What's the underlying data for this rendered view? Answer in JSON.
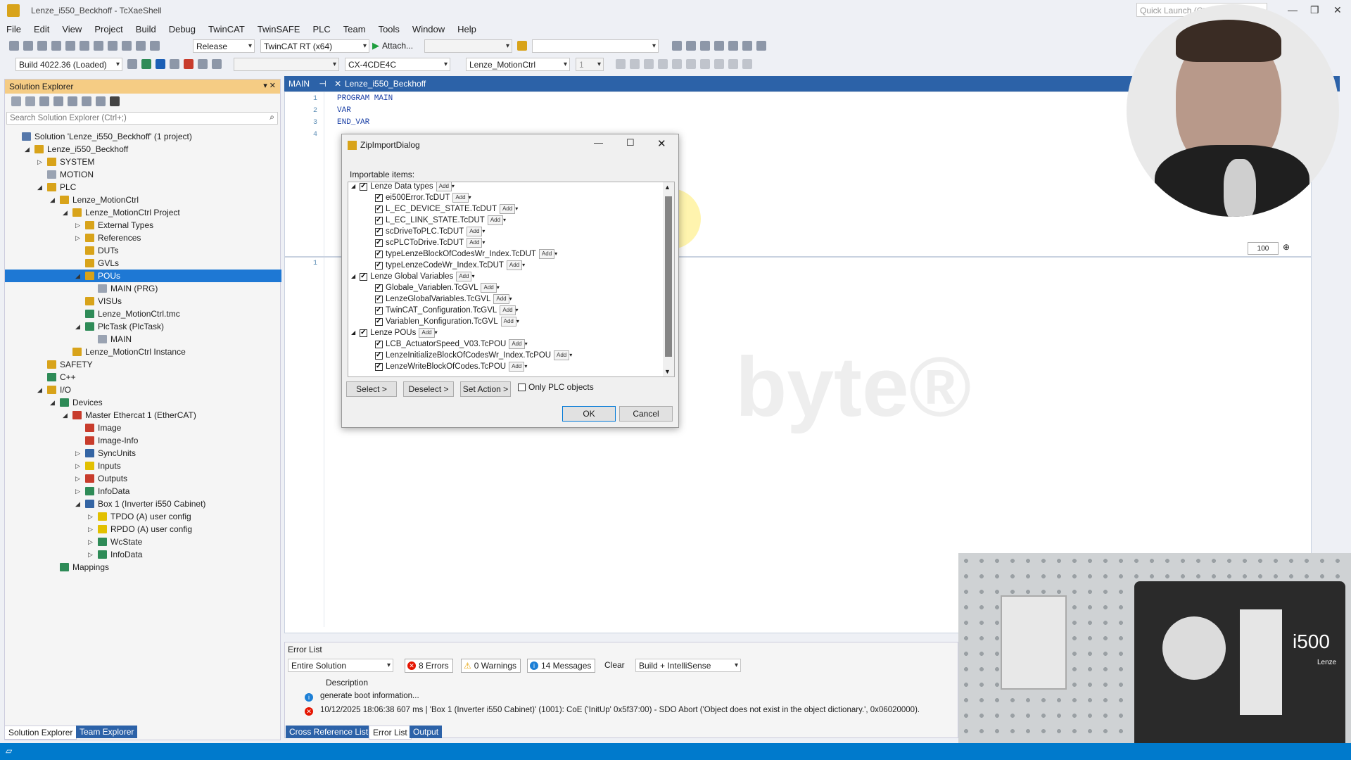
{
  "window": {
    "title": "Lenze_i550_Beckhoff - TcXaeShell",
    "quick_launch": "Quick Launch (Ctrl+Q)"
  },
  "menu": [
    "File",
    "Edit",
    "View",
    "Project",
    "Build",
    "Debug",
    "TwinCAT",
    "TwinSAFE",
    "PLC",
    "Team",
    "Tools",
    "Window",
    "Help"
  ],
  "toolbar1": {
    "config": "Release",
    "platform": "TwinCAT RT (x64)",
    "attach": "Attach..."
  },
  "toolbar2": {
    "build": "Build 4022.36 (Loaded)",
    "target": "CX-4CDE4C",
    "project": "Lenze_MotionCtrl",
    "task_num": "1"
  },
  "solution_explorer": {
    "title": "Solution Explorer",
    "search_placeholder": "Search Solution Explorer (Ctrl+;)",
    "tree": [
      {
        "label": "Solution 'Lenze_i550_Beckhoff' (1 project)",
        "indent": 0,
        "tri": ""
      },
      {
        "label": "Lenze_i550_Beckhoff",
        "indent": 1,
        "tri": "◢"
      },
      {
        "label": "SYSTEM",
        "indent": 2,
        "tri": "▷"
      },
      {
        "label": "MOTION",
        "indent": 2,
        "tri": ""
      },
      {
        "label": "PLC",
        "indent": 2,
        "tri": "◢"
      },
      {
        "label": "Lenze_MotionCtrl",
        "indent": 3,
        "tri": "◢"
      },
      {
        "label": "Lenze_MotionCtrl Project",
        "indent": 4,
        "tri": "◢"
      },
      {
        "label": "External Types",
        "indent": 5,
        "tri": "▷"
      },
      {
        "label": "References",
        "indent": 5,
        "tri": "▷"
      },
      {
        "label": "DUTs",
        "indent": 5,
        "tri": ""
      },
      {
        "label": "GVLs",
        "indent": 5,
        "tri": ""
      },
      {
        "label": "POUs",
        "indent": 5,
        "tri": "◢",
        "selected": true
      },
      {
        "label": "MAIN (PRG)",
        "indent": 6,
        "tri": ""
      },
      {
        "label": "VISUs",
        "indent": 5,
        "tri": ""
      },
      {
        "label": "Lenze_MotionCtrl.tmc",
        "indent": 5,
        "tri": ""
      },
      {
        "label": "PlcTask (PlcTask)",
        "indent": 5,
        "tri": "◢"
      },
      {
        "label": "MAIN",
        "indent": 6,
        "tri": ""
      },
      {
        "label": "Lenze_MotionCtrl Instance",
        "indent": 4,
        "tri": ""
      },
      {
        "label": "SAFETY",
        "indent": 2,
        "tri": ""
      },
      {
        "label": "C++",
        "indent": 2,
        "tri": ""
      },
      {
        "label": "I/O",
        "indent": 2,
        "tri": "◢"
      },
      {
        "label": "Devices",
        "indent": 3,
        "tri": "◢"
      },
      {
        "label": "Master Ethercat 1 (EtherCAT)",
        "indent": 4,
        "tri": "◢"
      },
      {
        "label": "Image",
        "indent": 5,
        "tri": ""
      },
      {
        "label": "Image-Info",
        "indent": 5,
        "tri": ""
      },
      {
        "label": "SyncUnits",
        "indent": 5,
        "tri": "▷"
      },
      {
        "label": "Inputs",
        "indent": 5,
        "tri": "▷"
      },
      {
        "label": "Outputs",
        "indent": 5,
        "tri": "▷"
      },
      {
        "label": "InfoData",
        "indent": 5,
        "tri": "▷"
      },
      {
        "label": "Box 1 (Inverter i550 Cabinet)",
        "indent": 5,
        "tri": "◢"
      },
      {
        "label": "TPDO (A) user config",
        "indent": 6,
        "tri": "▷"
      },
      {
        "label": "RPDO (A) user config",
        "indent": 6,
        "tri": "▷"
      },
      {
        "label": "WcState",
        "indent": 6,
        "tri": "▷"
      },
      {
        "label": "InfoData",
        "indent": 6,
        "tri": "▷"
      },
      {
        "label": "Mappings",
        "indent": 3,
        "tri": ""
      }
    ],
    "bottom_tabs": [
      "Solution Explorer",
      "Team Explorer"
    ]
  },
  "editor": {
    "tabs": [
      "MAIN",
      "Lenze_i550_Beckhoff"
    ],
    "lines": [
      "PROGRAM MAIN",
      "VAR",
      "END_VAR",
      ""
    ],
    "line_numbers": [
      "1",
      "2",
      "3",
      "4"
    ],
    "lower_line_number": "1",
    "zoom": "100"
  },
  "dialog": {
    "title": "ZipImportDialog",
    "importable_label": "Importable items:",
    "add_label": "Add",
    "items": [
      {
        "label": "Lenze Data types",
        "group": true
      },
      {
        "label": "ei500Error.TcDUT",
        "group": false
      },
      {
        "label": "L_EC_DEVICE_STATE.TcDUT",
        "group": false
      },
      {
        "label": "L_EC_LINK_STATE.TcDUT",
        "group": false
      },
      {
        "label": "scDriveToPLC.TcDUT",
        "group": false
      },
      {
        "label": "scPLCToDrive.TcDUT",
        "group": false
      },
      {
        "label": "typeLenzeBlockOfCodesWr_Index.TcDUT",
        "group": false
      },
      {
        "label": "typeLenzeCodeWr_Index.TcDUT",
        "group": false
      },
      {
        "label": "Lenze Global Variables",
        "group": true
      },
      {
        "label": "Globale_Variablen.TcGVL",
        "group": false
      },
      {
        "label": "LenzeGlobalVariables.TcGVL",
        "group": false
      },
      {
        "label": "TwinCAT_Configuration.TcGVL",
        "group": false
      },
      {
        "label": "Variablen_Konfiguration.TcGVL",
        "group": false
      },
      {
        "label": "Lenze POUs",
        "group": true
      },
      {
        "label": "LCB_ActuatorSpeed_V03.TcPOU",
        "group": false
      },
      {
        "label": "LenzeInitializeBlockOfCodesWr_Index.TcPOU",
        "group": false
      },
      {
        "label": "LenzeWriteBlockOfCodes.TcPOU",
        "group": false
      }
    ],
    "select_btn": "Select >",
    "deselect_btn": "Deselect >",
    "set_action_btn": "Set Action >",
    "only_plc_label": "Only PLC objects",
    "ok": "OK",
    "cancel": "Cancel"
  },
  "error_list": {
    "title": "Error List",
    "scope": "Entire Solution",
    "errors": "8 Errors",
    "warnings": "0 Warnings",
    "messages": "14 Messages",
    "clear": "Clear",
    "filter": "Build + IntelliSense",
    "column": "Description",
    "rows": [
      {
        "type": "info",
        "text": "generate boot information..."
      },
      {
        "type": "error",
        "text": "10/12/2025 18:06:38 607 ms | 'Box 1 (Inverter i550 Cabinet)' (1001): CoE ('InitUp' 0x5f37:00) - SDO Abort ('Object does not exist in the object dictionary.', 0x06020000)."
      }
    ]
  },
  "bottom_tabs": [
    "Cross Reference List",
    "Error List",
    "Output"
  ],
  "watermark": "byte®",
  "pip": {
    "device_label": "i500",
    "brand": "Lenze"
  }
}
